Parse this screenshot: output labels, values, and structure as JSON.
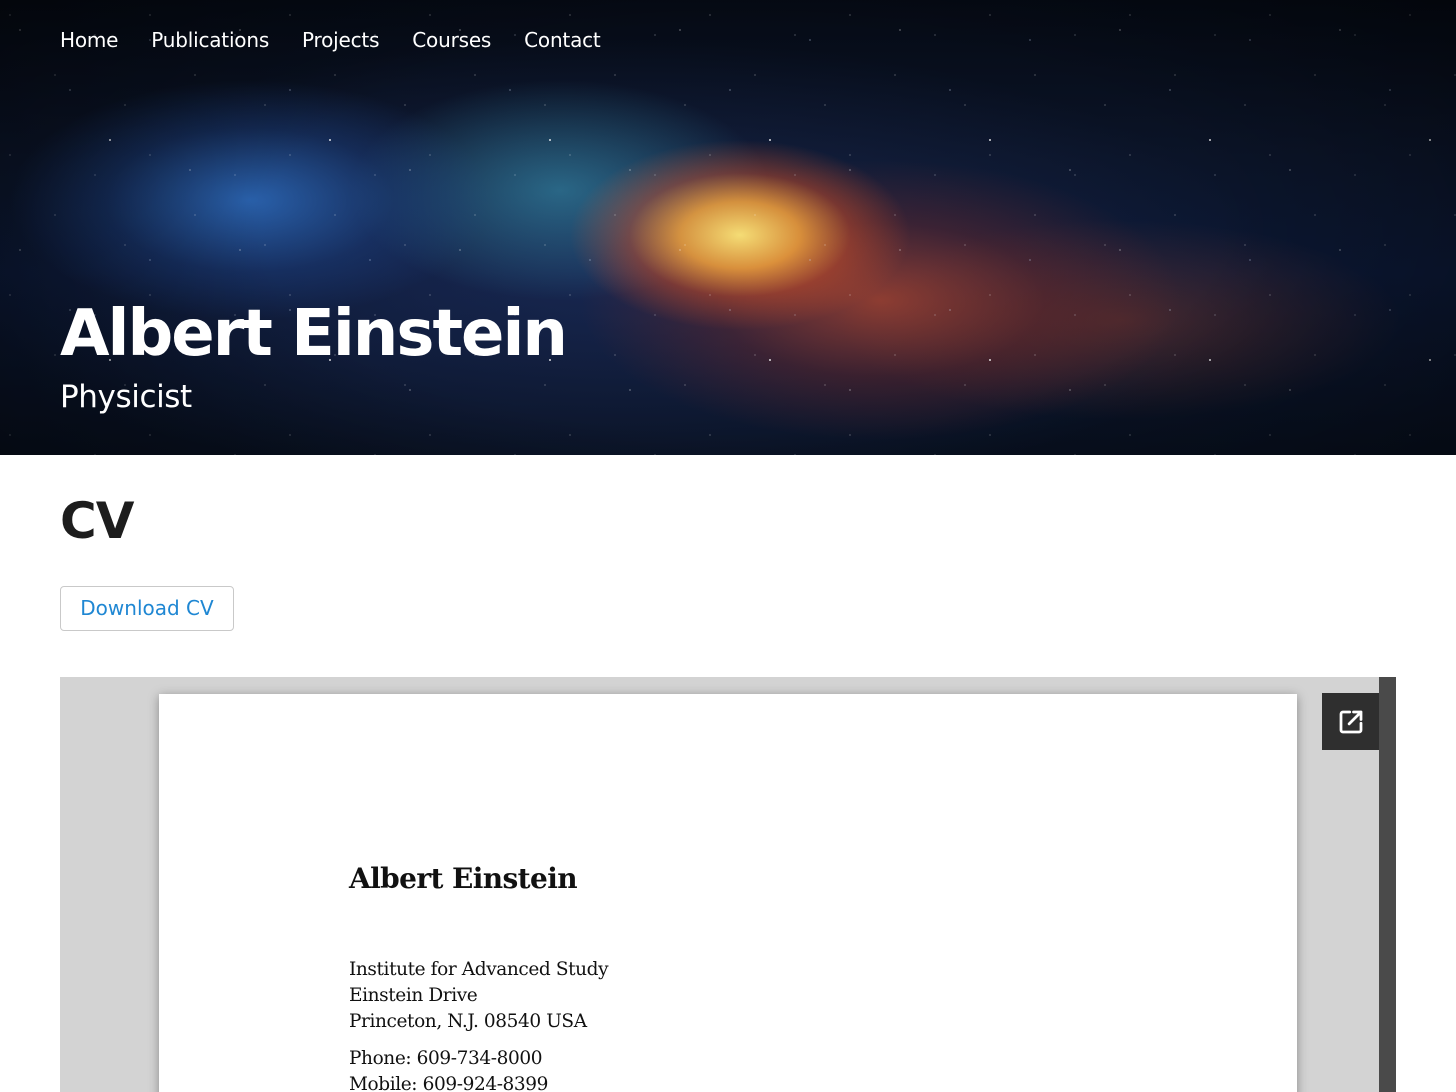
{
  "nav": {
    "items": [
      {
        "label": "Home"
      },
      {
        "label": "Publications"
      },
      {
        "label": "Projects"
      },
      {
        "label": "Courses"
      },
      {
        "label": "Contact"
      }
    ]
  },
  "hero": {
    "title": "Albert Einstein",
    "subtitle": "Physicist"
  },
  "main": {
    "heading": "CV",
    "download_label": "Download CV"
  },
  "pdf_viewer": {
    "popout_icon": "open-in-new-icon",
    "document": {
      "name": "Albert Einstein",
      "address_lines": [
        "Institute for Advanced Study",
        "Einstein Drive",
        "Princeton, N.J. 08540 USA"
      ],
      "phone": "Phone: 609-734-8000",
      "mobile": "Mobile: 609-924-8399"
    }
  },
  "colors": {
    "link_accent": "#1f87d3",
    "viewer_background": "#d3d3d3",
    "heading_text": "#1d1d1d"
  }
}
